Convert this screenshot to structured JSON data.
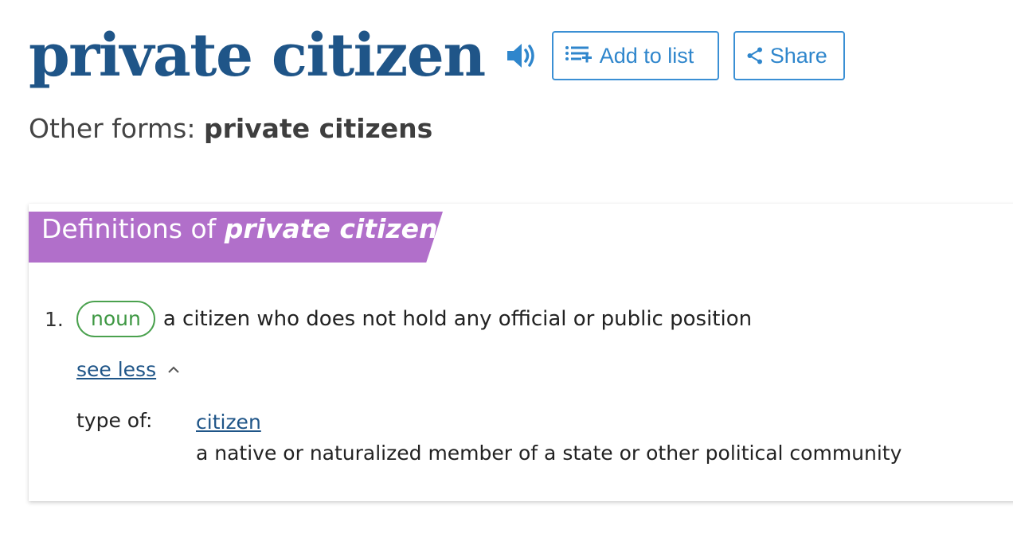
{
  "word": {
    "title": "private citizen",
    "audio_icon": "speaker-icon"
  },
  "actions": {
    "add_to_list_label": "Add to list",
    "add_to_list_icon": "list-add-icon",
    "share_label": "Share",
    "share_icon": "share-icon"
  },
  "other_forms": {
    "label": "Other forms:",
    "value": "private citizens"
  },
  "definitions": {
    "heading_prefix": "Definitions of",
    "heading_word": "private citizen",
    "senses": [
      {
        "number": "1.",
        "part_of_speech": "noun",
        "definition": "a citizen who does not hold any official or public position",
        "see_less_label": "see less",
        "type_of_label": "type of:",
        "type_of_word": "citizen",
        "type_of_definition": "a native or naturalized member of a state or other political community"
      }
    ]
  },
  "colors": {
    "title": "#1f5588",
    "action_blue": "#2f86cc",
    "banner_purple": "#b16fca",
    "noun_green": "#3d9742"
  }
}
